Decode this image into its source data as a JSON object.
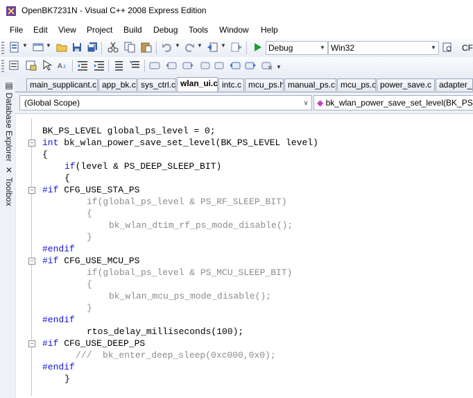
{
  "window": {
    "title": "OpenBK7231N - Visual C++ 2008 Express Edition"
  },
  "menu": [
    "File",
    "Edit",
    "View",
    "Project",
    "Build",
    "Debug",
    "Tools",
    "Window",
    "Help"
  ],
  "toolbar": {
    "config": "Debug",
    "platform": "Win32",
    "find_text": "CFG"
  },
  "side_panel": {
    "tab1": "Database Explorer",
    "tab2": "Toolbox"
  },
  "tabs": [
    "main_supplicant.c",
    "app_bk.c",
    "sys_ctrl.c",
    "wlan_ui.c",
    "intc.c",
    "mcu_ps.h",
    "manual_ps.c",
    "mcu_ps.c",
    "power_save.c",
    "adapter_p"
  ],
  "active_tab": "wlan_ui.c",
  "scope": {
    "left": "(Global Scope)",
    "right": "bk_wlan_power_save_set_level(BK_PS_LE"
  },
  "code": [
    {
      "text": "BK_PS_LEVEL global_ps_level = 0;",
      "indent": 0,
      "style": "normal"
    },
    {
      "kw": "int",
      "text": " bk_wlan_power_save_set_level(BK_PS_LEVEL level)",
      "indent": 0,
      "style": "normal",
      "fold": "-"
    },
    {
      "text": "{",
      "indent": 0,
      "style": "normal"
    },
    {
      "kw": "if",
      "text": "(level & PS_DEEP_SLEEP_BIT)",
      "indent": 1,
      "style": "normal"
    },
    {
      "text": "{",
      "indent": 1,
      "style": "normal"
    },
    {
      "kw": "#if",
      "text": " CFG_USE_STA_PS",
      "indent": 0,
      "style": "normal",
      "fold": "-"
    },
    {
      "text": "if(global_ps_level & PS_RF_SLEEP_BIT)",
      "indent": 2,
      "style": "dis"
    },
    {
      "text": "{",
      "indent": 2,
      "style": "dis"
    },
    {
      "text": "bk_wlan_dtim_rf_ps_mode_disable();",
      "indent": 3,
      "style": "dis"
    },
    {
      "text": "}",
      "indent": 2,
      "style": "dis"
    },
    {
      "kw": "#endif",
      "text": "",
      "indent": 0,
      "style": "normal"
    },
    {
      "kw": "#if",
      "text": " CFG_USE_MCU_PS",
      "indent": 0,
      "style": "normal",
      "fold": "-"
    },
    {
      "text": "if(global_ps_level & PS_MCU_SLEEP_BIT)",
      "indent": 2,
      "style": "dis"
    },
    {
      "text": "{",
      "indent": 2,
      "style": "dis"
    },
    {
      "text": "bk_wlan_mcu_ps_mode_disable();",
      "indent": 3,
      "style": "dis"
    },
    {
      "text": "}",
      "indent": 2,
      "style": "dis"
    },
    {
      "kw": "#endif",
      "text": "",
      "indent": 0,
      "style": "normal"
    },
    {
      "text": "rtos_delay_milliseconds(100);",
      "indent": 2,
      "style": "normal"
    },
    {
      "kw": "#if",
      "text": " CFG_USE_DEEP_PS",
      "indent": 0,
      "style": "normal",
      "fold": "-"
    },
    {
      "text": "///  bk_enter_deep_sleep(0xc000,0x0);",
      "indent": 1.5,
      "style": "dis"
    },
    {
      "kw": "#endif",
      "text": "",
      "indent": 0,
      "style": "normal"
    },
    {
      "text": "}",
      "indent": 1,
      "style": "normal"
    }
  ],
  "colors": {
    "keyword": "#1212d9",
    "disabled": "#8c8c8c",
    "toolbar": "#e9edf5",
    "play": "#1aa02c"
  },
  "icons": [
    "app-icon",
    "new-project-icon",
    "add-item-icon",
    "open-icon",
    "save-icon",
    "save-all-icon",
    "cut-icon",
    "copy-icon",
    "paste-icon",
    "undo-icon",
    "redo-icon",
    "navigate-back-icon",
    "navigate-forward-icon",
    "start-debugging-icon",
    "find-icon"
  ]
}
